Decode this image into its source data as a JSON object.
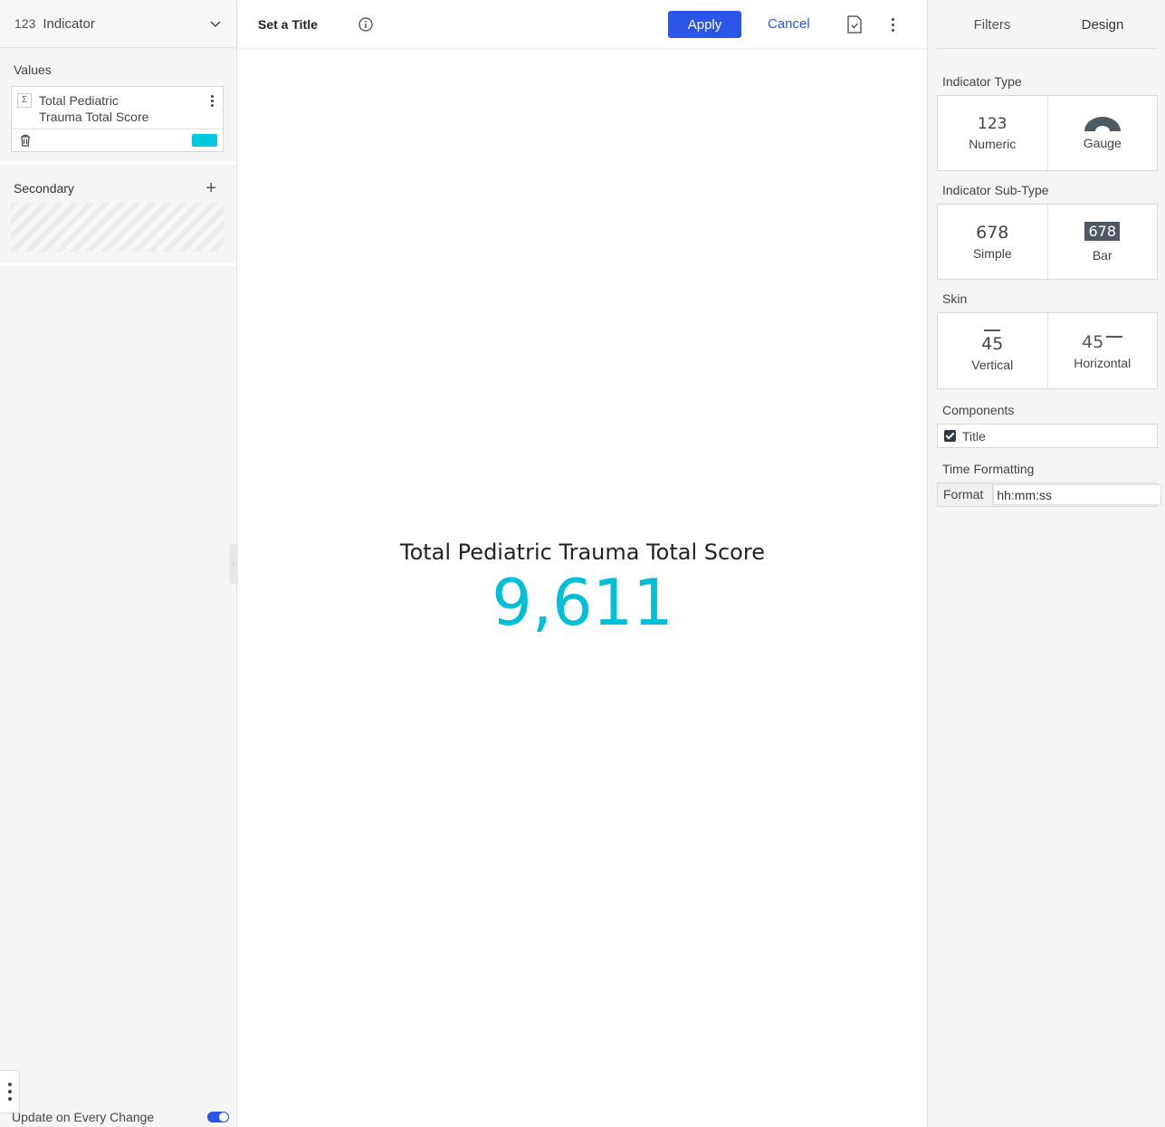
{
  "left": {
    "widget_type_num": "123",
    "widget_type_label": "Indicator",
    "values_title": "Values",
    "value_item": {
      "sigma": "Σ",
      "name": "Total Pediatric Trauma Total Score",
      "color": "#00c8e0"
    },
    "secondary_title": "Secondary",
    "update_label": "Update on Every Change",
    "update_on": true
  },
  "toolbar": {
    "title": "Set a Title",
    "apply_label": "Apply",
    "cancel_label": "Cancel"
  },
  "indicator": {
    "title": "Total Pediatric Trauma Total Score",
    "value": "9,611",
    "value_color": "#00c0d8"
  },
  "right": {
    "tabs": [
      {
        "label": "Filters",
        "active": false
      },
      {
        "label": "Design",
        "active": true
      }
    ],
    "indicator_type": {
      "title": "Indicator Type",
      "options": [
        {
          "glyph": "123",
          "label": "Numeric"
        },
        {
          "icon": "gauge-icon",
          "label": "Gauge"
        }
      ]
    },
    "indicator_subtype": {
      "title": "Indicator Sub-Type",
      "options": [
        {
          "glyph": "678",
          "label": "Simple"
        },
        {
          "glyph": "678",
          "label": "Bar"
        }
      ]
    },
    "skin": {
      "title": "Skin",
      "options": [
        {
          "glyph": "45",
          "label": "Vertical"
        },
        {
          "glyph": "45",
          "label": "Horizontal"
        }
      ]
    },
    "components": {
      "title": "Components",
      "title_checkbox_label": "Title",
      "title_checked": true
    },
    "time_formatting": {
      "title": "Time Formatting",
      "format_label": "Format",
      "format_value": "hh:mm:ss"
    }
  },
  "colors": {
    "accent": "#2b55e6",
    "indicator_value": "#00c0d8",
    "swatch": "#00c8e0",
    "bar_subtype_bg": "#4d5a64"
  }
}
